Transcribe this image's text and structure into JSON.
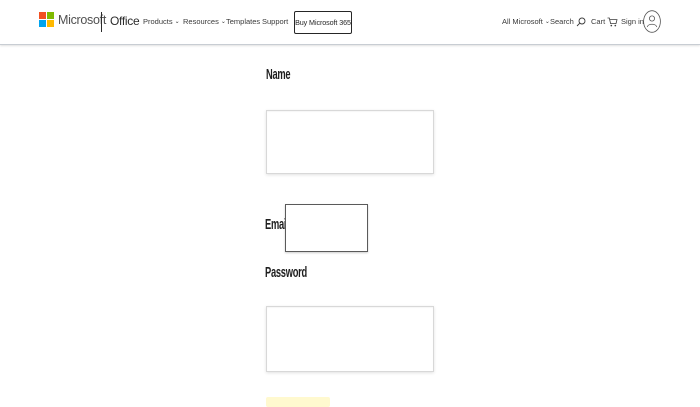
{
  "header": {
    "logo_colors": [
      "#f25022",
      "#7fba00",
      "#00a4ef",
      "#ffb900"
    ],
    "brand": "Microsoft",
    "product": "Office",
    "nav": [
      {
        "label": "Products",
        "has_dropdown": true,
        "icon": "chevron-down-icon"
      },
      {
        "label": "Resources",
        "has_dropdown": true,
        "icon": "chevron-down-icon"
      },
      {
        "label": "Templates",
        "has_dropdown": false
      },
      {
        "label": "Support",
        "has_dropdown": false
      }
    ],
    "buy_button": "Buy Microsoft 365",
    "right": {
      "all_microsoft": "All Microsoft",
      "search": "Search",
      "cart": "Cart",
      "sign_in": "Sign in",
      "icons": [
        "chevron-down-icon",
        "search-icon",
        "cart-icon",
        "avatar-icon"
      ]
    }
  },
  "form": {
    "name_label": "Name",
    "name_value": "",
    "email_label": "Email",
    "email_value": "",
    "password_label": "Password",
    "password_value": "",
    "submit_color": "#fff9cf"
  }
}
